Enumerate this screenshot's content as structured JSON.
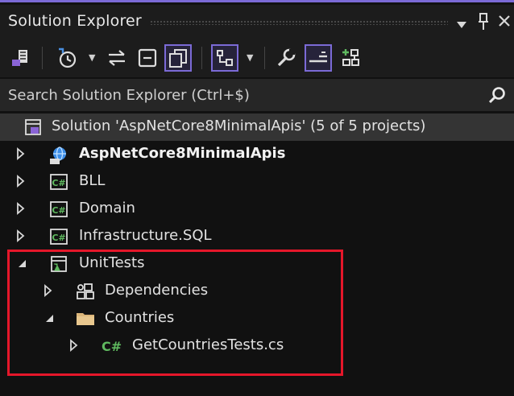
{
  "window": {
    "title": "Solution Explorer"
  },
  "toolbar": {
    "buttons": [
      {
        "name": "switch-views-icon"
      },
      {
        "name": "pending-changes-icon"
      },
      {
        "name": "sync-active-document-icon"
      },
      {
        "name": "collapse-all-icon"
      },
      {
        "name": "show-all-files-icon"
      },
      {
        "name": "preview-icon"
      },
      {
        "name": "properties-icon"
      },
      {
        "name": "preview-selected-items-icon"
      },
      {
        "name": "new-solution-view-icon"
      }
    ]
  },
  "search": {
    "placeholder": "Search Solution Explorer (Ctrl+$)"
  },
  "tree": {
    "solution": {
      "label": "Solution 'AspNetCore8MinimalApis' (5 of 5 projects)"
    },
    "items": [
      {
        "label": "AspNetCore8MinimalApis",
        "bold": true,
        "icon": "web-project-icon",
        "expanded": false
      },
      {
        "label": "BLL",
        "icon": "csharp-project-icon",
        "expanded": false
      },
      {
        "label": "Domain",
        "icon": "csharp-project-icon",
        "expanded": false
      },
      {
        "label": "Infrastructure.SQL",
        "icon": "csharp-project-icon",
        "expanded": false
      },
      {
        "label": "UnitTests",
        "icon": "test-project-icon",
        "expanded": true
      },
      {
        "label": "Dependencies",
        "icon": "dependencies-icon",
        "expanded": false
      },
      {
        "label": "Countries",
        "icon": "folder-icon",
        "expanded": true
      },
      {
        "label": "GetCountriesTests.cs",
        "icon": "csharp-file-icon",
        "expanded": false
      }
    ]
  },
  "colors": {
    "accent": "#7b6ad6",
    "highlight_box": "#e5172a",
    "folder": "#dcb67a",
    "csharp_green": "#5fb95f",
    "web_blue": "#3d8ee8"
  }
}
